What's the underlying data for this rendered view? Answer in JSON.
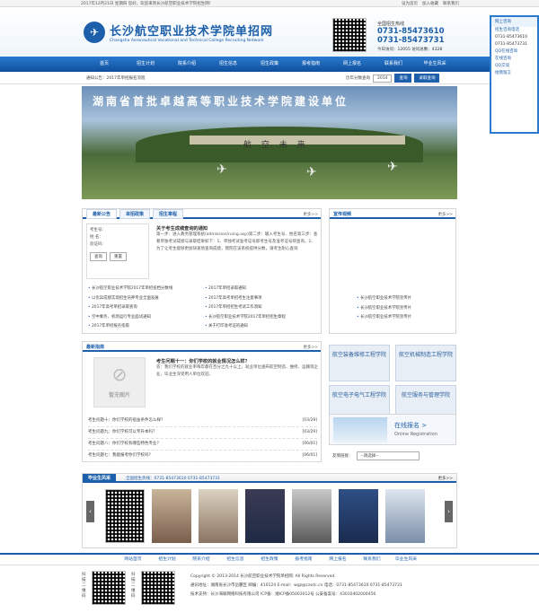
{
  "topbar": {
    "welcome": "2017年12月21日 星期四 您好，欢迎来到长沙航空职业技术学院招生网！",
    "links": [
      "设为首页",
      "加入收藏",
      "联系我们"
    ]
  },
  "header": {
    "school_cn": "长沙航空职业技术学院单招网",
    "school_en": "Changsha Aeronautical Vocational and Technical College Recruiting Network",
    "hotline_title": "全国招生热线",
    "phone1": "0731-85473610",
    "phone2": "0731-85473731",
    "counts": "今日访问：12055  访问总数：4328"
  },
  "nav": [
    "首页",
    "招生计划",
    "院系介绍",
    "招生信息",
    "招生政策",
    "报考指南",
    "网上报名",
    "联系我们",
    "毕业生风采"
  ],
  "notice": {
    "text": "通知公告：2017年单招报名流程",
    "year_label": "历年分数查询",
    "year": "2014",
    "search_btn": "查询",
    "score_btn": "录取查询"
  },
  "banner": {
    "title": "湖南省首批卓越高等职业技术学院建设单位",
    "slogan": "航 空 未 来"
  },
  "news": {
    "tabs": [
      "最新公告",
      "单招政策",
      "招生章程"
    ],
    "more": "更多>>",
    "headline": "关于考生成绩查询的通知",
    "body": "第一步：进入教务管理系统(admission/ruing.asp)第二步：输入考生号、姓名第三步：查看单独考试成绩与录取结果如下：1、单独考试准考证号即考生号及准考证号即查询，2、为了让考生能够更加快速地查询成绩，我院在该系统提供分数，请考生耐心查询",
    "form": {
      "label1": "考生号：",
      "label2": "姓  名：",
      "label3": "验证码：",
      "submit": "查询",
      "reset": "重置"
    },
    "list": [
      "长沙航空职业技术学院2017年单招投档分数线",
      "2017年单招录取通知",
      "以优异成绩实现招生培养专业全面发展",
      "2017年高考单招考生注意事项",
      "2017年高考单招录取查询",
      "2017年单招招生考试工作须知",
      "2017年单招考试科目和内容",
      "2017年招生简章发布",
      "空中乘务、机场运行专业面试通知",
      "2017年单招志愿填报",
      "长沙航空职业技术学院2017年单招招生章程",
      "关于招生考试补报名的通知",
      "2017年单招报名指南",
      "关于打印准考证的通知"
    ]
  },
  "video": {
    "title": "宣传视频",
    "more": "更多>>",
    "items": [
      "长沙航空职业技术学院宣传片",
      "长沙航空职业技术学院宣传片",
      "长沙航空职业技术学院宣传片"
    ]
  },
  "guide": {
    "title": "最新指南",
    "more": "更多>>",
    "headline": "考生问题十一：你们学校的就业情况怎么样？",
    "body": "答：我们学校的就业率每年都在百分之九十以上，就业单位遍布航空制造、维修、运输等企业，毕业生深受用人单位欢迎。",
    "noimg": "暂无图片",
    "qa": [
      {
        "q": "考生问题十：你们学校的宿舍条件怎么样？",
        "d": "[03/29]"
      },
      {
        "q": "考生问题九：你们学校可以专升本吗？",
        "d": "[03/29]"
      },
      {
        "q": "考生问题八：你们学校有哪些特色专业？",
        "d": "[06/01]"
      },
      {
        "q": "考生问题七：我能报考你们学校吗？",
        "d": "[06/01]"
      }
    ]
  },
  "majors": [
    "航空装备维修工程学院",
    "航空机械制造工程学院",
    "航空电子电气工程学院",
    "航空服务与管理学院"
  ],
  "online": {
    "title": "在线报名 >",
    "sub": "Online Registration"
  },
  "links": {
    "label": "友情链接：",
    "select": "--请选择--"
  },
  "alumni": {
    "title": "毕业生风采",
    "phone": "全国招生热线：0731-85473610  0731-85473731",
    "more": "更多>>"
  },
  "footnav": [
    "网站首页",
    "招生计划",
    "院系介绍",
    "招生信息",
    "招生政策",
    "报考指南",
    "网上报名",
    "联系我们",
    "毕业生风采"
  ],
  "footer": {
    "copy": "Copyright © 2013-2014 长沙航空职业技术学院单招网. All Rights Reserved.",
    "addr": "通讯地址：湖南省长沙市岳麓区  邮编：410124  E-mail：wgz@cavtc.cn  电话：0731-85473610  0731-85473731",
    "tech": "技术支持：长沙海联网络科技有限公司  ICP备：湘ICP备05003012号  公安备案号：43010402000456",
    "qr1": "扫描二维码",
    "qr2": "扫描二维码"
  },
  "float": {
    "online": "网上咨询",
    "phone": "招生咨询电话",
    "p1": "0731-85473610",
    "p2": "0731-85473731",
    "qq": "QQ在线咨询",
    "qq1": "在线咨询",
    "qq2": "QQ交谈",
    "msg": "给我留言"
  }
}
